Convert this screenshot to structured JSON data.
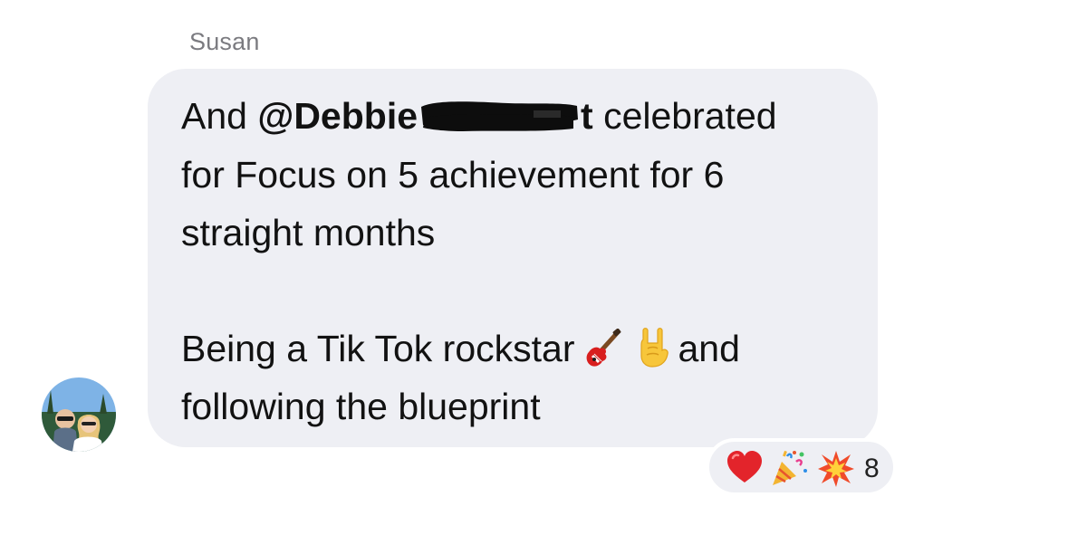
{
  "sender": {
    "name": "Susan"
  },
  "message": {
    "line1_prefix": "And ",
    "mention": "@Debbie",
    "mention_tail": "t",
    "line1_suffix": " celebrated",
    "line2": "for Focus on 5 achievement for 6",
    "line3": "straight months",
    "line4_prefix": "Being a Tik Tok rockstar",
    "line4_suffix": "and",
    "line5": "following the blueprint",
    "emojis": [
      "guitar-icon",
      "rock-on-hand-icon"
    ]
  },
  "reactions": {
    "icons": [
      "heart-icon",
      "party-popper-icon",
      "explosion-icon"
    ],
    "count": "8"
  },
  "colors": {
    "bubble": "#eeeff4",
    "sender_text": "#7b7b80",
    "message_text": "#121212"
  }
}
